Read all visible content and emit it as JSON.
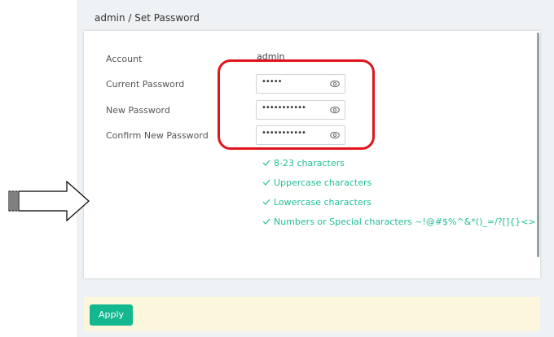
{
  "panel": {
    "title": "admin / Set Password"
  },
  "form": {
    "account_label": "Account",
    "account_value": "admin",
    "current_label": "Current Password",
    "current_value": "•••••",
    "new_label": "New Password",
    "new_value": "•••••••••••",
    "confirm_label": "Confirm New Password",
    "confirm_value": "•••••••••••"
  },
  "rules": [
    {
      "text": "8-23 characters"
    },
    {
      "text": "Uppercase characters"
    },
    {
      "text": "Lowercase characters"
    },
    {
      "text": "Numbers or Special characters ~!@#$%^&*()_=/?[]{}<>`"
    }
  ],
  "footer": {
    "apply_label": "Apply"
  },
  "icons": {
    "check": "check-icon",
    "eye": "eye-icon",
    "arrow": "right-arrow-icon"
  },
  "colors": {
    "accent": "#14b88f",
    "rule_text": "#1fbf95",
    "highlight": "#e0141e",
    "footer_bg": "#fcf7dc"
  }
}
